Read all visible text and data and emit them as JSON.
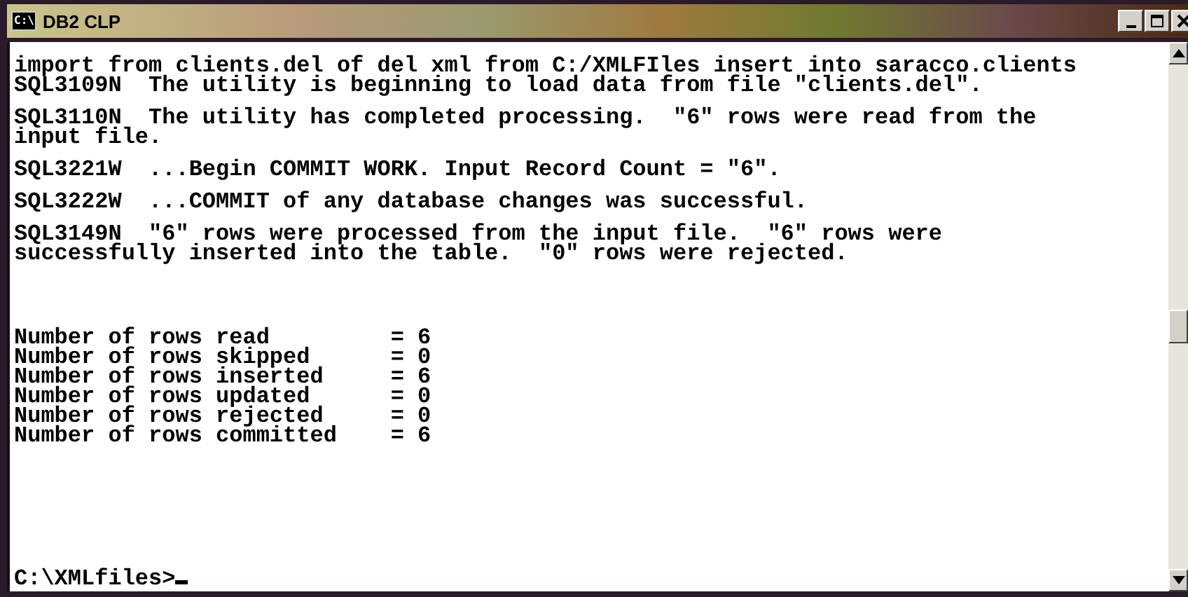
{
  "window": {
    "title": "DB2 CLP",
    "icon_text": "C:\\"
  },
  "console": {
    "blocks": [
      {
        "kind": "message",
        "lines": [
          "import from clients.del of del xml from C:/XMLFIles insert into saracco.clients",
          "SQL3109N  The utility is beginning to load data from file \"clients.del\"."
        ]
      },
      {
        "kind": "message",
        "lines": [
          "SQL3110N  The utility has completed processing.  \"6\" rows were read from the",
          "input file."
        ]
      },
      {
        "kind": "message",
        "lines": [
          "SQL3221W  ...Begin COMMIT WORK. Input Record Count = \"6\"."
        ]
      },
      {
        "kind": "message",
        "lines": [
          "SQL3222W  ...COMMIT of any database changes was successful."
        ]
      },
      {
        "kind": "message",
        "lines": [
          "SQL3149N  \"6\" rows were processed from the input file.  \"6\" rows were",
          "successfully inserted into the table.  \"0\" rows were rejected."
        ]
      },
      {
        "kind": "summary",
        "lines": [
          "Number of rows read         = 6",
          "Number of rows skipped      = 0",
          "Number of rows inserted     = 6",
          "Number of rows updated      = 0",
          "Number of rows rejected     = 0",
          "Number of rows committed    = 6"
        ]
      },
      {
        "kind": "prompt",
        "lines": [
          "C:\\XMLfiles>"
        ]
      }
    ]
  }
}
